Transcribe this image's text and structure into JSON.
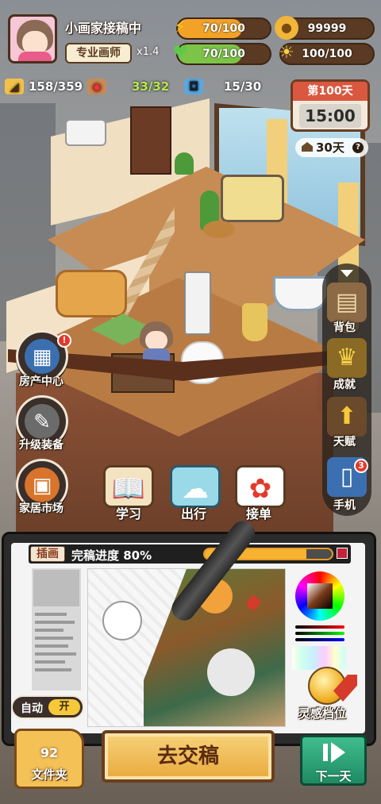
{
  "player": {
    "name": "小画家接稿中",
    "title": "专业画师",
    "multiplier": "x1.4"
  },
  "stats": {
    "energy": "70/100",
    "energy_level": 0.7,
    "health": "70/100",
    "health_level": 0.7,
    "coins": "99999",
    "inspiration": "100/100"
  },
  "resources": {
    "fame": "158/359",
    "paint": "33/32",
    "photos": "15/30"
  },
  "calendar": {
    "day": "第100天",
    "time": "15:00",
    "rent_days": "30天"
  },
  "left_menu": [
    {
      "label": "房产中心",
      "badge": "!"
    },
    {
      "label": "升级装备"
    },
    {
      "label": "家居市场"
    }
  ],
  "center_actions": [
    {
      "label": "学习"
    },
    {
      "label": "出行"
    },
    {
      "label": "接单"
    }
  ],
  "right_menu": [
    {
      "label": "背包"
    },
    {
      "label": "成就"
    },
    {
      "label": "天赋"
    },
    {
      "label": "手机",
      "badge": "3"
    }
  ],
  "tablet": {
    "tab": "插画",
    "progress_label": "完稿进度 80%",
    "progress": 0.8,
    "inspiration_label": "灵感档位"
  },
  "bottom": {
    "auto_label": "自动",
    "auto_state": "开",
    "folder_count": "92",
    "folder_label": "文件夹",
    "submit_label": "去交稿",
    "next_day_label": "下一天"
  },
  "colors": {
    "energy_fill": "#f2a227",
    "health_fill": "#7cc348",
    "accent_brown": "#5a3a22",
    "submit_gold": "#e9a93d",
    "next_green": "#1f8a63"
  }
}
